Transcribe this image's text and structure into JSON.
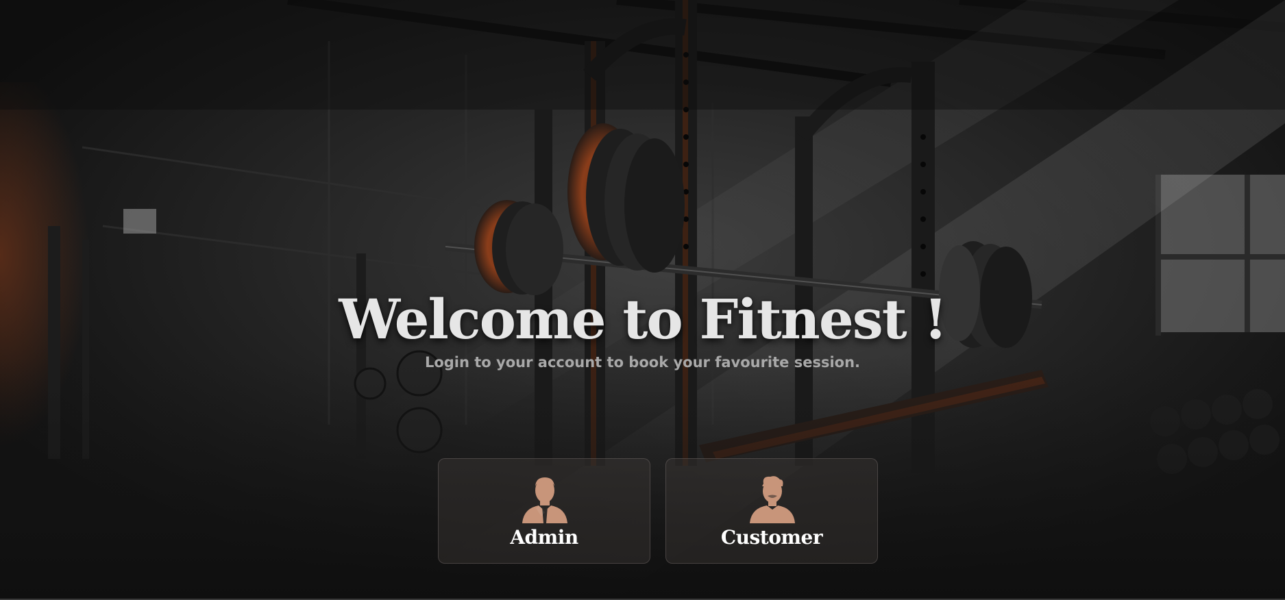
{
  "hero": {
    "title": "Welcome to Fitnest !",
    "subtitle": "Login to your account to book your favourite session."
  },
  "roles": [
    {
      "label": "Admin",
      "icon": "admin-avatar-icon"
    },
    {
      "label": "Customer",
      "icon": "customer-avatar-icon"
    }
  ],
  "colors": {
    "accent": "#c8957a",
    "title": "#e6e6e6",
    "subtitle": "#a9a9a9",
    "card_bg": "#3e3a38",
    "rust": "#8a3d1a"
  }
}
